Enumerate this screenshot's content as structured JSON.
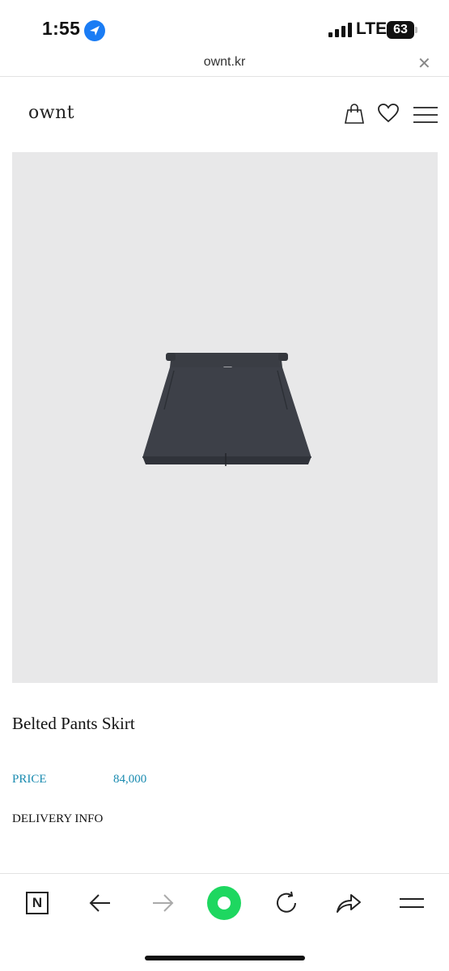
{
  "status_bar": {
    "time": "1:55",
    "network": "LTE",
    "battery": "63"
  },
  "browser": {
    "url": "ownt.kr",
    "close_glyph": "✕"
  },
  "site": {
    "logo": "ownt"
  },
  "product": {
    "name": "Belted Pants Skirt",
    "price_label": "PRICE",
    "price_value": "84,000",
    "delivery_label": "DELIVERY INFO"
  },
  "toolbar": {
    "home_label": "N",
    "icons": [
      "naver-home-icon",
      "back-icon",
      "forward-icon",
      "green-dot-icon",
      "reload-icon",
      "share-icon",
      "menu-icon"
    ]
  },
  "colors": {
    "accent": "#1a8bb0",
    "green": "#1ed760",
    "image_bg": "#e8e8e9"
  }
}
